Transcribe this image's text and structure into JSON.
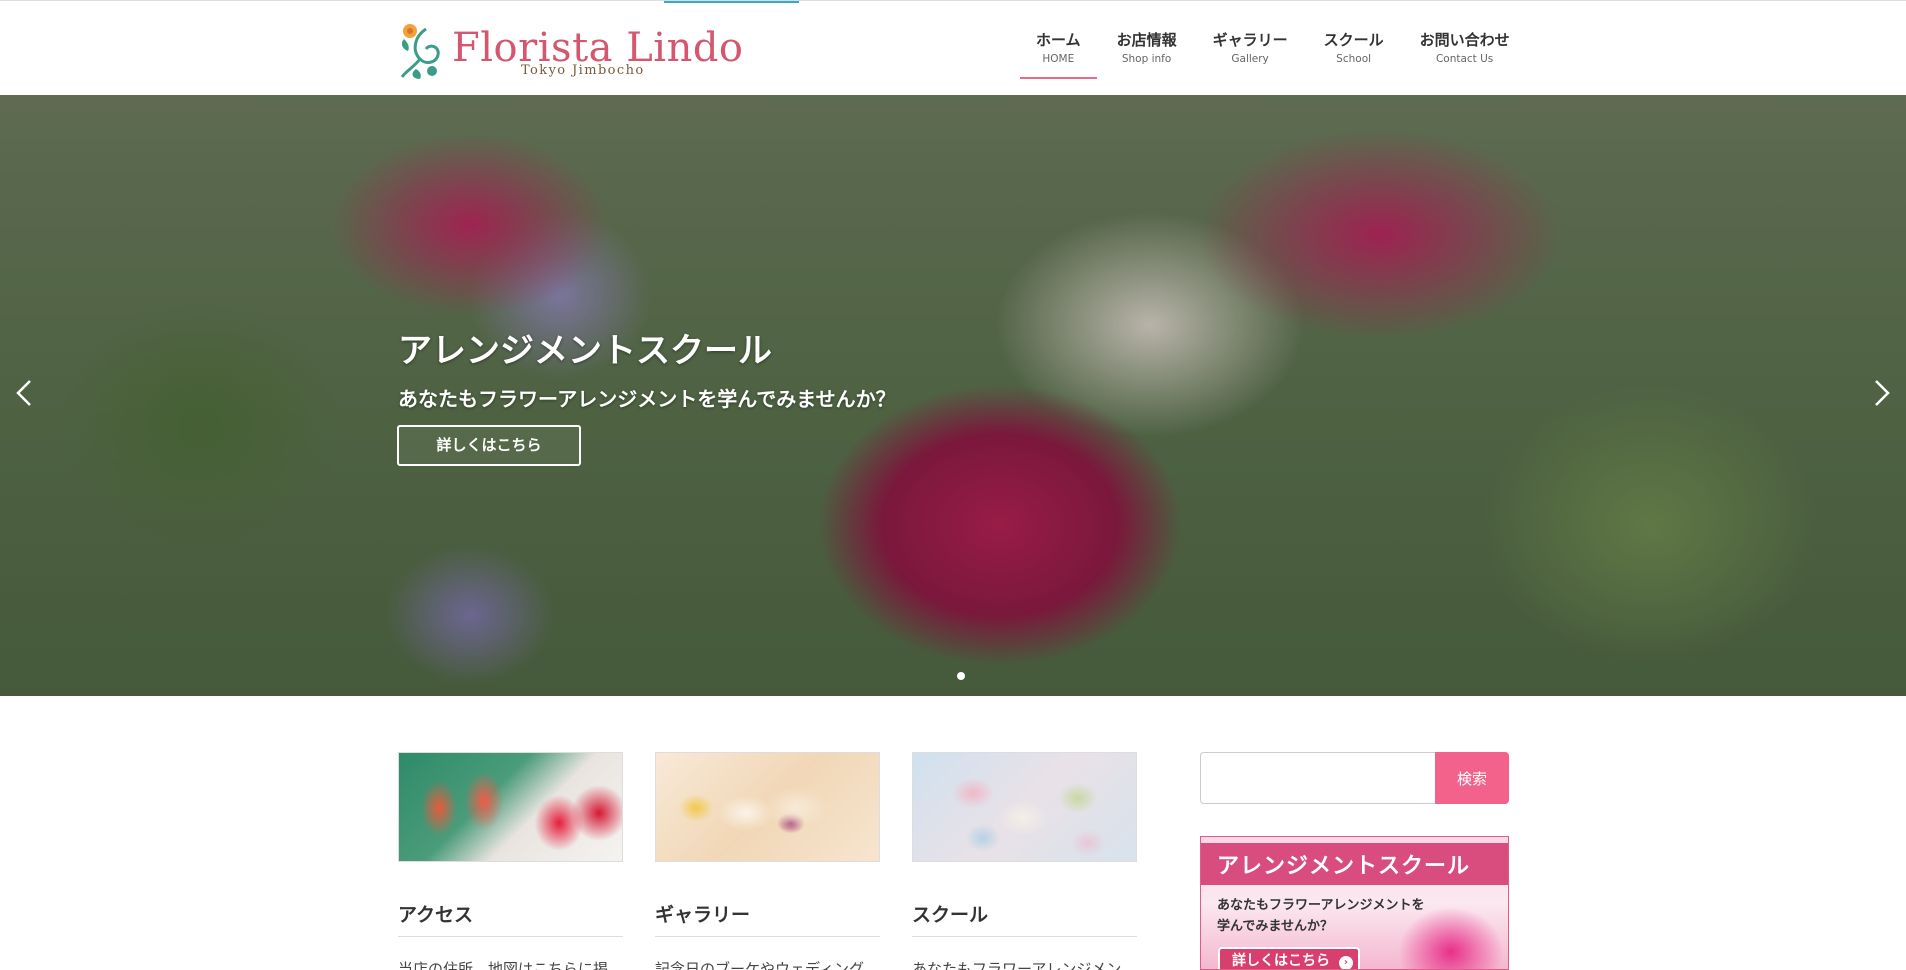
{
  "header": {
    "logo": {
      "name": "Florista Lindo",
      "sub": "Tokyo Jimbocho"
    },
    "nav": [
      {
        "jp": "ホーム",
        "en": "HOME"
      },
      {
        "jp": "お店情報",
        "en": "Shop info"
      },
      {
        "jp": "ギャラリー",
        "en": "Gallery"
      },
      {
        "jp": "スクール",
        "en": "School"
      },
      {
        "jp": "お問い合わせ",
        "en": "Contact Us"
      }
    ],
    "active_nav": "ホーム"
  },
  "hero": {
    "title": "アレンジメントスクール",
    "subtitle": "あなたもフラワーアレンジメントを学んでみませんか？",
    "button": "詳しくはこちら",
    "slide_count": 1,
    "current_slide": 1
  },
  "cards": [
    {
      "title": "アクセス",
      "excerpt": "当店の住所、地図はこちらに掲"
    },
    {
      "title": "ギャラリー",
      "excerpt": "記念日のブーケやウェディング"
    },
    {
      "title": "スクール",
      "excerpt": "あなたもフラワーアレンジメン"
    }
  ],
  "sidebar": {
    "search": {
      "value": "",
      "button": "検索"
    },
    "banner": {
      "title": "アレンジメントスクール",
      "line1": "あなたもフラワーアレンジメントを",
      "line2": "学んでみませんか？",
      "button": "詳しくはこちら"
    }
  },
  "colors": {
    "accent": "#f2628a",
    "logo": "#d4576f",
    "banner_band": "#d84d7d"
  }
}
